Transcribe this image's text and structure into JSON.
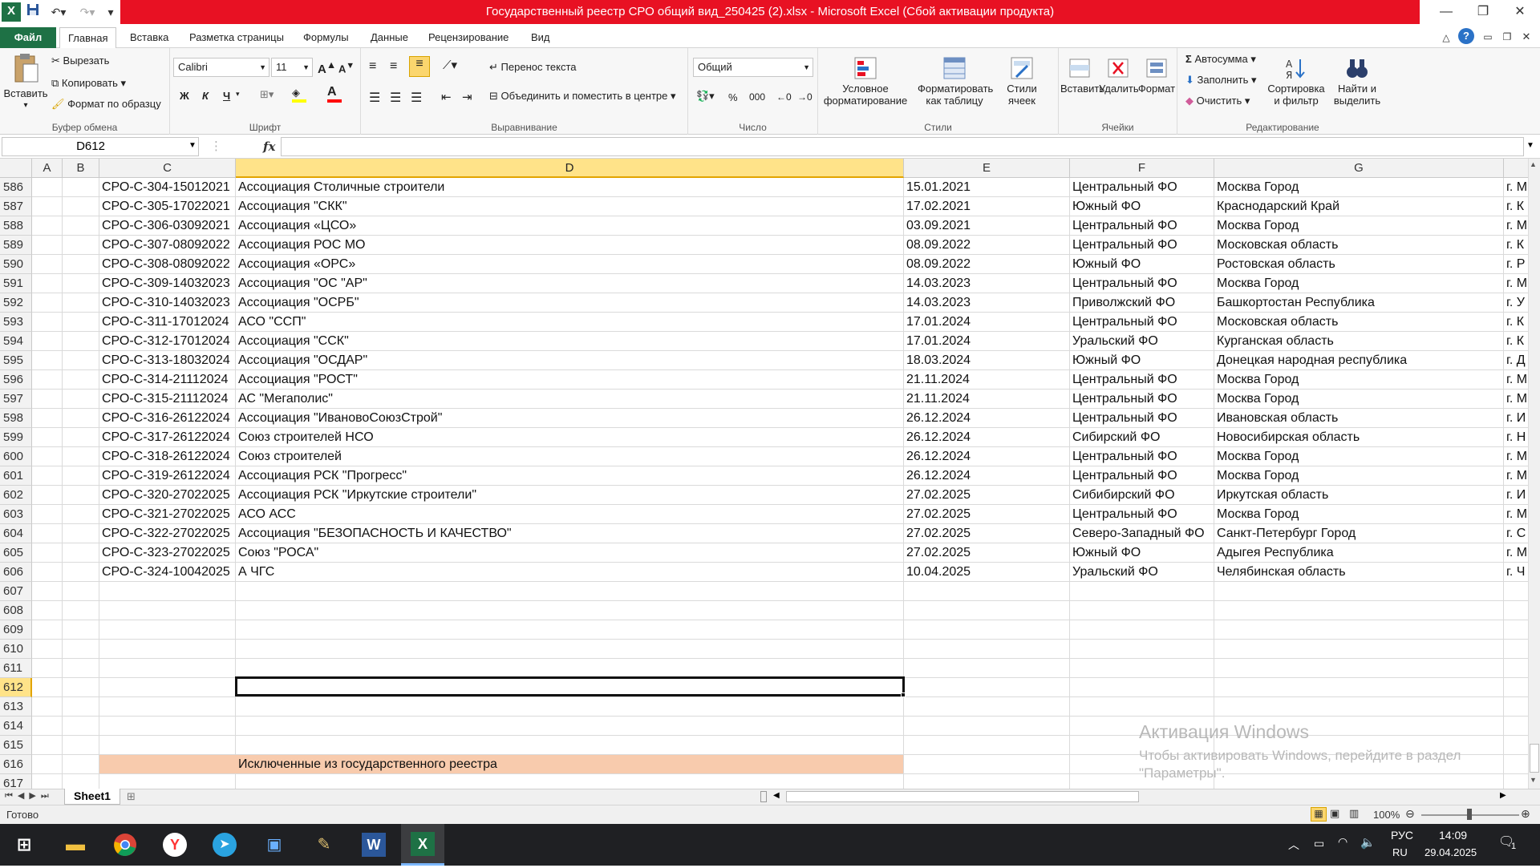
{
  "window": {
    "title": "Государственный реестр СРО общий вид_250425 (2).xlsx - Microsoft Excel (Сбой активации продукта)"
  },
  "tabs": [
    {
      "label": "Файл"
    },
    {
      "label": "Главная"
    },
    {
      "label": "Вставка"
    },
    {
      "label": "Разметка страницы"
    },
    {
      "label": "Формулы"
    },
    {
      "label": "Данные"
    },
    {
      "label": "Рецензирование"
    },
    {
      "label": "Вид"
    }
  ],
  "ribbon": {
    "clipboard": {
      "paste": "Вставить",
      "cut": "Вырезать",
      "copy": "Копировать",
      "format_painter": "Формат по образцу",
      "label": "Буфер обмена"
    },
    "font": {
      "name": "Calibri",
      "size": "11",
      "label": "Шрифт",
      "bold": "Ж",
      "italic": "К",
      "underline": "Ч"
    },
    "alignment": {
      "wrap": "Перенос текста",
      "merge": "Объединить и поместить в центре",
      "label": "Выравнивание"
    },
    "number": {
      "format": "Общий",
      "label": "Число",
      "percent": "%",
      "thousands": "000"
    },
    "styles": {
      "conditional": "Условное форматирование",
      "as_table": "Форматировать как таблицу",
      "cell_styles": "Стили ячеек",
      "label": "Стили"
    },
    "cells": {
      "insert": "Вставить",
      "delete": "Удалить",
      "format": "Формат",
      "label": "Ячейки"
    },
    "editing": {
      "autosum": "Автосумма",
      "fill": "Заполнить",
      "clear": "Очистить",
      "sort": "Сортировка и фильтр",
      "find": "Найти и выделить",
      "label": "Редактирование"
    }
  },
  "formula_bar": {
    "name_box": "D612",
    "fx": "fx",
    "formula": ""
  },
  "columns": [
    "A",
    "B",
    "C",
    "D",
    "E",
    "F",
    "G"
  ],
  "rows": [
    {
      "n": "586",
      "c": "СРО-С-304-15012021",
      "d": "Ассоциация Столичные строители",
      "e": "15.01.2021",
      "f": "Центральный ФО",
      "g": "Москва Город",
      "h": "г. М"
    },
    {
      "n": "587",
      "c": "СРО-С-305-17022021",
      "d": "Ассоциация \"СКК\"",
      "e": "17.02.2021",
      "f": "Южный ФО",
      "g": "Краснодарский Край",
      "h": "г. К"
    },
    {
      "n": "588",
      "c": "СРО-С-306-03092021",
      "d": "Ассоциация «ЦСО»",
      "e": "03.09.2021",
      "f": "Центральный ФО",
      "g": "Москва Город",
      "h": "г. М"
    },
    {
      "n": "589",
      "c": "СРО-С-307-08092022",
      "d": "Ассоциация РОС МО",
      "e": "08.09.2022",
      "f": "Центральный ФО",
      "g": "Московская область",
      "h": "г. К"
    },
    {
      "n": "590",
      "c": "СРО-С-308-08092022",
      "d": "Ассоциация «ОРС»",
      "e": "08.09.2022",
      "f": "Южный ФО",
      "g": "Ростовская область",
      "h": "г. Р"
    },
    {
      "n": "591",
      "c": "СРО-С-309-14032023",
      "d": "Ассоциация \"ОС \"АР\"",
      "e": "14.03.2023",
      "f": "Центральный ФО",
      "g": "Москва Город",
      "h": "г. М"
    },
    {
      "n": "592",
      "c": "СРО-С-310-14032023",
      "d": "Ассоциация \"ОСРБ\"",
      "e": "14.03.2023",
      "f": "Приволжский ФО",
      "g": "Башкортостан Республика",
      "h": "г. У"
    },
    {
      "n": "593",
      "c": "СРО-С-311-17012024",
      "d": "АСО \"ССП\"",
      "e": "17.01.2024",
      "f": "Центральный ФО",
      "g": "Московская область",
      "h": "г. К"
    },
    {
      "n": "594",
      "c": "СРО-С-312-17012024",
      "d": "Ассоциация \"ССК\"",
      "e": "17.01.2024",
      "f": "Уральский ФО",
      "g": "Курганская область",
      "h": "г. К"
    },
    {
      "n": "595",
      "c": "СРО-С-313-18032024",
      "d": "Ассоциация \"ОСДАР\"",
      "e": "18.03.2024",
      "f": "Южный ФО",
      "g": "Донецкая народная республика",
      "h": "г. Д"
    },
    {
      "n": "596",
      "c": "СРО-С-314-21112024",
      "d": "Ассоциация \"РОСТ\"",
      "e": "21.11.2024",
      "f": "Центральный ФО",
      "g": "Москва Город",
      "h": "г. М"
    },
    {
      "n": "597",
      "c": "СРО-С-315-21112024",
      "d": "АС \"Мегаполис\"",
      "e": "21.11.2024",
      "f": "Центральный ФО",
      "g": "Москва Город",
      "h": "г. М"
    },
    {
      "n": "598",
      "c": "СРО-С-316-26122024",
      "d": "Ассоциация \"ИвановоСоюзСтрой\"",
      "e": "26.12.2024",
      "f": "Центральный ФО",
      "g": "Ивановская область",
      "h": "г. И"
    },
    {
      "n": "599",
      "c": "СРО-С-317-26122024",
      "d": "Союз строителей НСО",
      "e": "26.12.2024",
      "f": "Сибирский ФО",
      "g": "Новосибирская область",
      "h": "г. Н"
    },
    {
      "n": "600",
      "c": "СРО-С-318-26122024",
      "d": "Союз строителей",
      "e": "26.12.2024",
      "f": "Центральный ФО",
      "g": "Москва Город",
      "h": "г. М"
    },
    {
      "n": "601",
      "c": "СРО-С-319-26122024",
      "d": "Ассоциация РСК \"Прогресс\"",
      "e": "26.12.2024",
      "f": "Центральный ФО",
      "g": "Москва Город",
      "h": "г. М"
    },
    {
      "n": "602",
      "c": "СРО-С-320-27022025",
      "d": "Ассоциация РСК \"Иркутские строители\"",
      "e": "27.02.2025",
      "f": "Сибибирский ФО",
      "g": "Иркутская область",
      "h": "г. И"
    },
    {
      "n": "603",
      "c": "СРО-С-321-27022025",
      "d": "АСО АСС",
      "e": "27.02.2025",
      "f": "Центральный ФО",
      "g": "Москва Город",
      "h": "г. М"
    },
    {
      "n": "604",
      "c": "СРО-С-322-27022025",
      "d": "Ассоциация \"БЕЗОПАСНОСТЬ И КАЧЕСТВО\"",
      "e": "27.02.2025",
      "f": "Северо-Западный ФО",
      "g": "Санкт-Петербург Город",
      "h": "г. С"
    },
    {
      "n": "605",
      "c": "СРО-С-323-27022025",
      "d": "Союз \"РОСА\"",
      "e": "27.02.2025",
      "f": "Южный ФО",
      "g": "Адыгея Республика",
      "h": "г. М"
    },
    {
      "n": "606",
      "c": "СРО-С-324-10042025",
      "d": "А ЧГС",
      "e": "10.04.2025",
      "f": "Уральский ФО",
      "g": "Челябинская область",
      "h": "г. Ч"
    },
    {
      "n": "607",
      "c": "",
      "d": "",
      "e": "",
      "f": "",
      "g": "",
      "h": ""
    },
    {
      "n": "608",
      "c": "",
      "d": "",
      "e": "",
      "f": "",
      "g": "",
      "h": ""
    },
    {
      "n": "609",
      "c": "",
      "d": "",
      "e": "",
      "f": "",
      "g": "",
      "h": ""
    },
    {
      "n": "610",
      "c": "",
      "d": "",
      "e": "",
      "f": "",
      "g": "",
      "h": ""
    },
    {
      "n": "611",
      "c": "",
      "d": "",
      "e": "",
      "f": "",
      "g": "",
      "h": ""
    },
    {
      "n": "612",
      "c": "",
      "d": "",
      "e": "",
      "f": "",
      "g": "",
      "h": ""
    },
    {
      "n": "613",
      "c": "",
      "d": "",
      "e": "",
      "f": "",
      "g": "",
      "h": ""
    },
    {
      "n": "614",
      "c": "",
      "d": "",
      "e": "",
      "f": "",
      "g": "",
      "h": ""
    },
    {
      "n": "615",
      "c": "",
      "d": "",
      "e": "",
      "f": "",
      "g": "",
      "h": ""
    },
    {
      "n": "616",
      "c": "",
      "d": "Исключенные из государственного реестра",
      "e": "",
      "f": "",
      "g": "",
      "h": ""
    },
    {
      "n": "617",
      "c": "",
      "d": "",
      "e": "",
      "f": "",
      "g": "",
      "h": ""
    }
  ],
  "selected_row": "612",
  "highlight_row": "616",
  "colors": {
    "excel_green": "#1e7145",
    "title_red": "#e81123",
    "highlight": "#f8cbad",
    "selection": "#ffe389"
  },
  "sheet": {
    "name": "Sheet1"
  },
  "status": {
    "ready": "Готово",
    "zoom": "100%"
  },
  "watermark": {
    "title": "Активация Windows",
    "line1": "Чтобы активировать Windows, перейдите в раздел",
    "line2": "\"Параметры\"."
  },
  "taskbar": {
    "lang_top": "РУС",
    "lang_bottom": "RU",
    "time": "14:09",
    "date": "29.04.2025",
    "notifications": "1",
    "word": "W",
    "excel": "X",
    "yandex": "Y"
  }
}
